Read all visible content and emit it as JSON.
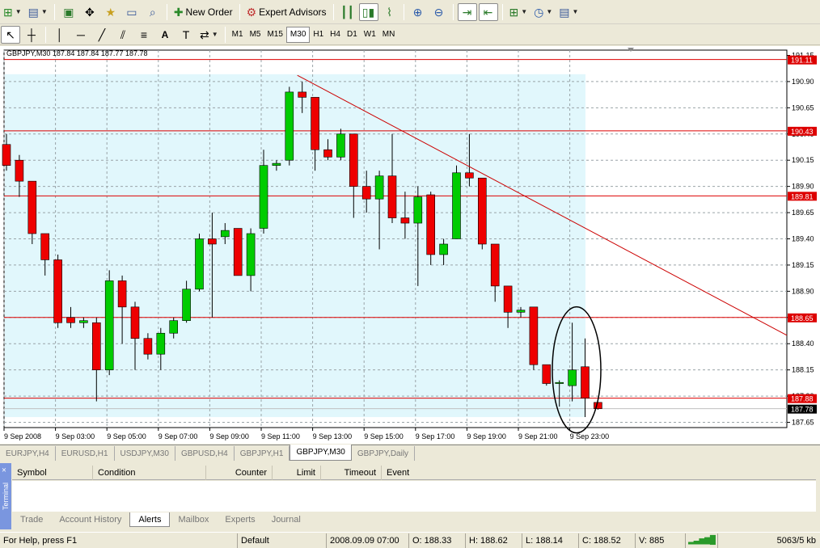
{
  "toolbar1": {
    "new_order": "New Order",
    "expert_advisors": "Expert Advisors"
  },
  "toolbar2": {
    "text_tool": "A",
    "timeframes": [
      "M1",
      "M5",
      "M15",
      "M30",
      "H1",
      "H4",
      "D1",
      "W1",
      "MN"
    ],
    "active_tf": "M30"
  },
  "chart": {
    "title": "GBPJPY,M30  187.84 187.84 187.77 187.78",
    "price_labels": [
      "191.15",
      "190.90",
      "190.65",
      "190.40",
      "190.15",
      "189.90",
      "189.65",
      "189.40",
      "189.15",
      "188.90",
      "188.65",
      "188.40",
      "188.15",
      "187.90",
      "187.65"
    ],
    "hline_labels": [
      "191.11",
      "190.43",
      "189.81",
      "188.65",
      "187.88"
    ],
    "current_price": "187.78",
    "time_labels": [
      "9 Sep 2008",
      "9 Sep 03:00",
      "9 Sep 05:00",
      "9 Sep 07:00",
      "9 Sep 09:00",
      "9 Sep 11:00",
      "9 Sep 13:00",
      "9 Sep 15:00",
      "9 Sep 17:00",
      "9 Sep 19:00",
      "9 Sep 21:00",
      "9 Sep 23:00"
    ],
    "colors": {
      "bull": "#00cc00",
      "bear": "#ee0000",
      "shade": "#e1f7fc",
      "hline": "#dd0000",
      "trend": "#cc0000"
    }
  },
  "chart_data": {
    "type": "candlestick",
    "symbol": "GBPJPY",
    "timeframe": "M30",
    "ylim": [
      187.6,
      191.2
    ],
    "horizontal_lines": [
      191.11,
      190.43,
      189.81,
      188.65,
      187.88
    ],
    "trendline": {
      "from": {
        "x": "9 Sep 11:30",
        "y": 190.96
      },
      "to": {
        "x": "off-chart",
        "y": 188.48
      }
    },
    "candles": [
      {
        "o": 190.3,
        "h": 190.4,
        "l": 190.05,
        "c": 190.1
      },
      {
        "o": 190.15,
        "h": 190.2,
        "l": 189.8,
        "c": 189.95
      },
      {
        "o": 189.95,
        "h": 189.95,
        "l": 189.35,
        "c": 189.45
      },
      {
        "o": 189.45,
        "h": 189.45,
        "l": 189.05,
        "c": 189.2
      },
      {
        "o": 189.2,
        "h": 189.25,
        "l": 188.55,
        "c": 188.6
      },
      {
        "o": 188.65,
        "h": 188.75,
        "l": 188.55,
        "c": 188.6
      },
      {
        "o": 188.6,
        "h": 188.65,
        "l": 188.55,
        "c": 188.62
      },
      {
        "o": 188.6,
        "h": 188.65,
        "l": 187.85,
        "c": 188.15
      },
      {
        "o": 188.15,
        "h": 189.1,
        "l": 188.1,
        "c": 189.0
      },
      {
        "o": 189.0,
        "h": 189.05,
        "l": 188.4,
        "c": 188.75
      },
      {
        "o": 188.75,
        "h": 188.8,
        "l": 188.15,
        "c": 188.45
      },
      {
        "o": 188.45,
        "h": 188.5,
        "l": 188.25,
        "c": 188.3
      },
      {
        "o": 188.3,
        "h": 188.55,
        "l": 188.15,
        "c": 188.5
      },
      {
        "o": 188.5,
        "h": 188.65,
        "l": 188.45,
        "c": 188.62
      },
      {
        "o": 188.62,
        "h": 189.0,
        "l": 188.6,
        "c": 188.92
      },
      {
        "o": 188.92,
        "h": 189.45,
        "l": 188.9,
        "c": 189.4
      },
      {
        "o": 189.4,
        "h": 189.65,
        "l": 188.65,
        "c": 189.35
      },
      {
        "o": 189.42,
        "h": 189.55,
        "l": 189.35,
        "c": 189.48
      },
      {
        "o": 189.5,
        "h": 189.5,
        "l": 189.05,
        "c": 189.05
      },
      {
        "o": 189.05,
        "h": 189.5,
        "l": 188.9,
        "c": 189.45
      },
      {
        "o": 189.5,
        "h": 190.25,
        "l": 189.45,
        "c": 190.1
      },
      {
        "o": 190.1,
        "h": 190.15,
        "l": 190.05,
        "c": 190.12
      },
      {
        "o": 190.15,
        "h": 190.85,
        "l": 190.1,
        "c": 190.8
      },
      {
        "o": 190.8,
        "h": 190.9,
        "l": 190.6,
        "c": 190.75
      },
      {
        "o": 190.75,
        "h": 190.75,
        "l": 190.05,
        "c": 190.25
      },
      {
        "o": 190.25,
        "h": 190.35,
        "l": 190.15,
        "c": 190.18
      },
      {
        "o": 190.18,
        "h": 190.45,
        "l": 190.15,
        "c": 190.4
      },
      {
        "o": 190.4,
        "h": 190.4,
        "l": 189.6,
        "c": 189.9
      },
      {
        "o": 189.9,
        "h": 190.05,
        "l": 189.65,
        "c": 189.78
      },
      {
        "o": 189.78,
        "h": 190.05,
        "l": 189.3,
        "c": 190.0
      },
      {
        "o": 190.0,
        "h": 190.4,
        "l": 189.55,
        "c": 189.6
      },
      {
        "o": 189.6,
        "h": 189.85,
        "l": 189.4,
        "c": 189.55
      },
      {
        "o": 189.55,
        "h": 189.9,
        "l": 188.95,
        "c": 189.8
      },
      {
        "o": 189.82,
        "h": 189.85,
        "l": 189.15,
        "c": 189.25
      },
      {
        "o": 189.25,
        "h": 189.4,
        "l": 189.15,
        "c": 189.35
      },
      {
        "o": 189.4,
        "h": 190.1,
        "l": 189.4,
        "c": 190.03
      },
      {
        "o": 190.03,
        "h": 190.4,
        "l": 189.9,
        "c": 189.98
      },
      {
        "o": 189.98,
        "h": 189.98,
        "l": 189.3,
        "c": 189.35
      },
      {
        "o": 189.35,
        "h": 189.35,
        "l": 188.8,
        "c": 188.95
      },
      {
        "o": 188.95,
        "h": 188.95,
        "l": 188.55,
        "c": 188.7
      },
      {
        "o": 188.7,
        "h": 188.75,
        "l": 188.65,
        "c": 188.72
      },
      {
        "o": 188.75,
        "h": 188.75,
        "l": 188.15,
        "c": 188.2
      },
      {
        "o": 188.2,
        "h": 188.2,
        "l": 188.0,
        "c": 188.02
      },
      {
        "o": 188.02,
        "h": 188.05,
        "l": 187.8,
        "c": 188.03
      },
      {
        "o": 188.0,
        "h": 188.6,
        "l": 187.85,
        "c": 188.15
      },
      {
        "o": 188.18,
        "h": 188.45,
        "l": 187.7,
        "c": 187.88
      },
      {
        "o": 187.84,
        "h": 187.84,
        "l": 187.77,
        "c": 187.78
      }
    ]
  },
  "chart_tabs": [
    "EURJPY,H4",
    "EURUSD,H1",
    "USDJPY,M30",
    "GBPUSD,H4",
    "GBPJPY,H1",
    "GBPJPY,M30",
    "GBPJPY,Daily"
  ],
  "active_chart_tab": "GBPJPY,M30",
  "terminal": {
    "side_label": "Terminal",
    "close": "×",
    "columns": [
      "Symbol",
      "Condition",
      "Counter",
      "Limit",
      "Timeout",
      "Event"
    ],
    "tabs": [
      "Trade",
      "Account History",
      "Alerts",
      "Mailbox",
      "Experts",
      "Journal"
    ],
    "active_tab": "Alerts"
  },
  "status": {
    "help": "For Help, press F1",
    "profile": "Default",
    "datetime": "2008.09.09 07:00",
    "open": "O: 188.33",
    "high": "H: 188.62",
    "low": "L: 188.14",
    "close": "C: 188.52",
    "volume": "V: 885",
    "traffic": "5063/5 kb"
  }
}
